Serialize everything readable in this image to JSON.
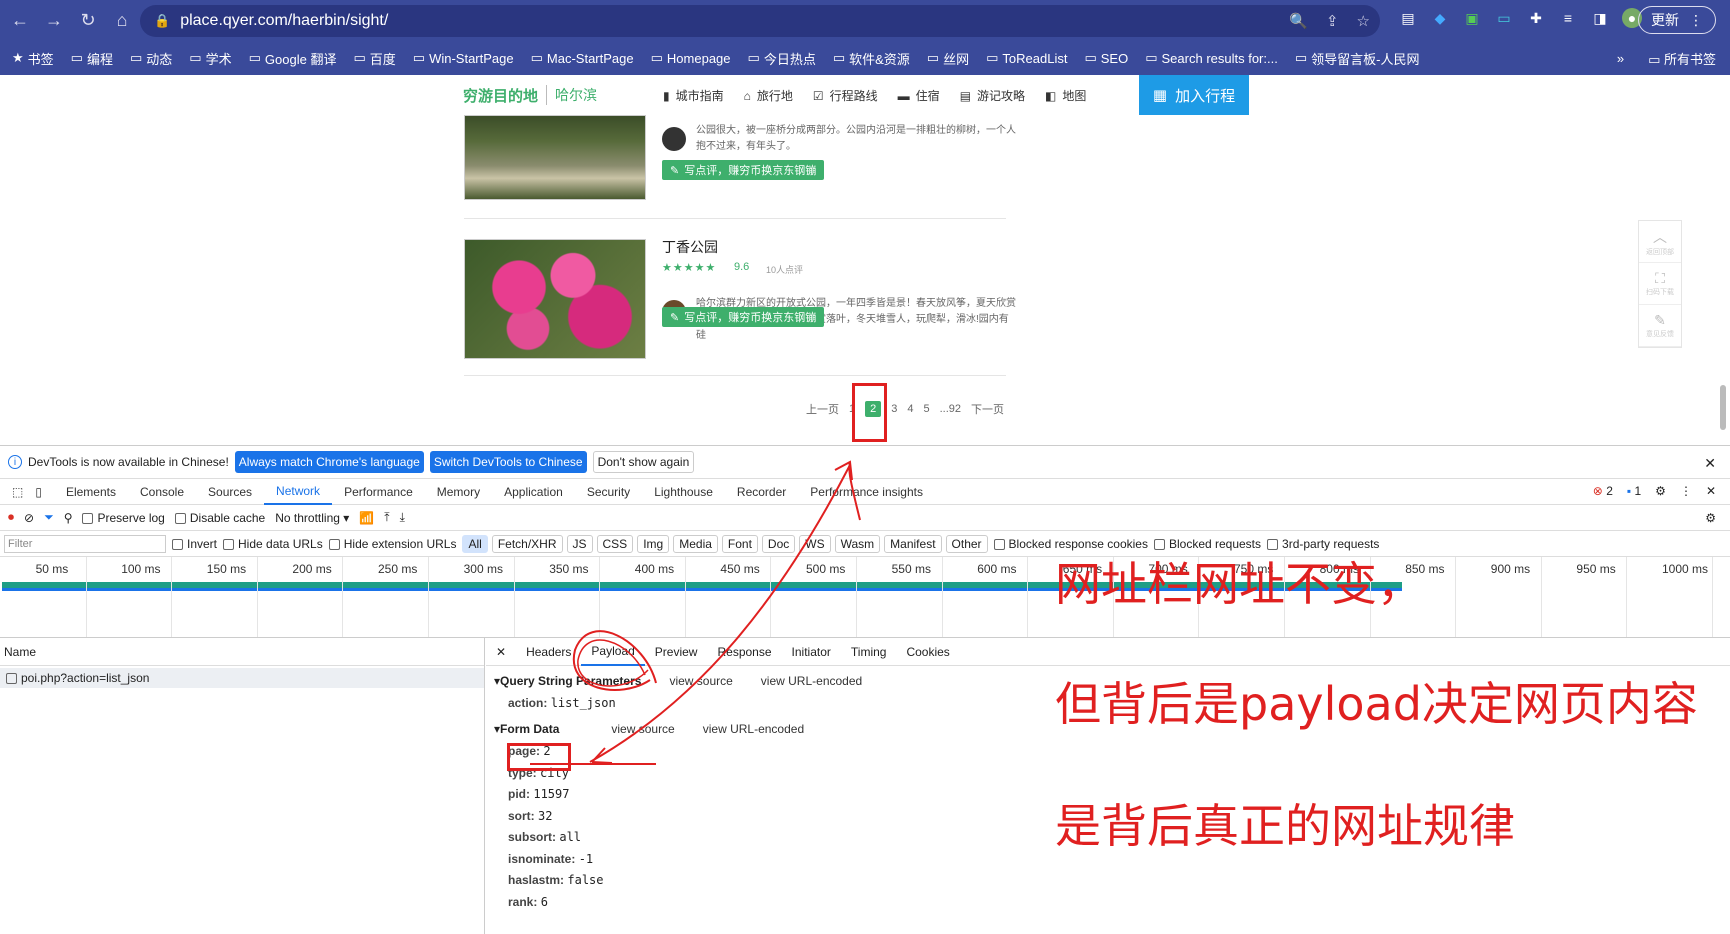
{
  "browser": {
    "url": "place.qyer.com/haerbin/sight/",
    "update_label": "更新",
    "bookmarks": [
      "书签",
      "编程",
      "动态",
      "学术",
      "Google 翻译",
      "百度",
      "Win-StartPage",
      "Mac-StartPage",
      "Homepage",
      "今日热点",
      "软件&资源",
      "丝网",
      "ToReadList",
      "SEO",
      "Search results for:...",
      "领导留言板-人民网"
    ],
    "bookmarks_more": "»",
    "bookmarks_all": "所有书签"
  },
  "site": {
    "logo": "穷游目的地",
    "city": "哈尔滨",
    "nav": [
      "城市指南",
      "旅行地",
      "行程路线",
      "住宿",
      "游记攻略",
      "地图"
    ],
    "join": "加入行程",
    "review1": "公园很大，被一座桥分成两部分。公园内沿河是一排粗壮的柳树，一个人抱不过来，有年头了。",
    "write_label": "写点评，赚穷币换京东钢镚",
    "place_title": "丁香公园",
    "stars": "★★★★★",
    "score": "9.6",
    "review_count": "10人点评",
    "review2": "哈尔滨群力新区的开放式公园，一年四季皆是景！春天放风筝，夏天欣赏园内的各品种丁香花，秋天赏落叶，冬天堆雪人，玩爬犁，滑冰!园内有硅",
    "pager": {
      "prev": "上一页",
      "p1": "1",
      "current": "2",
      "p3": "3",
      "p4": "4",
      "p5": "5",
      "last": "...92",
      "next": "下一页"
    },
    "side": {
      "top": "返回顶部",
      "scan": "扫码下载",
      "feedback": "意见反馈"
    }
  },
  "devtools": {
    "info": "DevTools is now available in Chinese!",
    "btn1": "Always match Chrome's language",
    "btn2": "Switch DevTools to Chinese",
    "btn3": "Don't show again",
    "tabs": [
      "Elements",
      "Console",
      "Sources",
      "Network",
      "Performance",
      "Memory",
      "Application",
      "Security",
      "Lighthouse",
      "Recorder",
      "Performance insights"
    ],
    "errors": "2",
    "messages": "1",
    "toolbar": {
      "preserve": "Preserve log",
      "cache": "Disable cache",
      "throttle": "No throttling"
    },
    "filter": {
      "placeholder": "Filter",
      "invert": "Invert",
      "hide_data": "Hide data URLs",
      "hide_ext": "Hide extension URLs",
      "types": [
        "All",
        "Fetch/XHR",
        "JS",
        "CSS",
        "Img",
        "Media",
        "Font",
        "Doc",
        "WS",
        "Wasm",
        "Manifest",
        "Other"
      ],
      "blocked_cookies": "Blocked response cookies",
      "blocked_req": "Blocked requests",
      "third": "3rd-party requests"
    },
    "ticks": [
      "50 ms",
      "100 ms",
      "150 ms",
      "200 ms",
      "250 ms",
      "300 ms",
      "350 ms",
      "400 ms",
      "450 ms",
      "500 ms",
      "550 ms",
      "600 ms",
      "650 ms",
      "700 ms",
      "750 ms",
      "800 ms",
      "850 ms",
      "900 ms",
      "950 ms",
      "1000 ms"
    ],
    "name_header": "Name",
    "request": "poi.php?action=list_json",
    "detail_tabs": [
      "Headers",
      "Payload",
      "Preview",
      "Response",
      "Initiator",
      "Timing",
      "Cookies"
    ],
    "qsp_title": "Query String Parameters",
    "view_source": "view source",
    "view_url": "view URL-encoded",
    "qsp": {
      "k": "action:",
      "v": "list_json"
    },
    "form_title": "Form Data",
    "form": [
      {
        "k": "page:",
        "v": "2"
      },
      {
        "k": "type:",
        "v": "city"
      },
      {
        "k": "pid:",
        "v": "11597"
      },
      {
        "k": "sort:",
        "v": "32"
      },
      {
        "k": "subsort:",
        "v": "all"
      },
      {
        "k": "isnominate:",
        "v": "-1"
      },
      {
        "k": "haslastm:",
        "v": "false"
      },
      {
        "k": "rank:",
        "v": "6"
      }
    ]
  },
  "annotations": {
    "a1": "网址栏网址不变，",
    "a2": "但背后是payload决定网页内容",
    "a3": "是背后真正的网址规律"
  }
}
